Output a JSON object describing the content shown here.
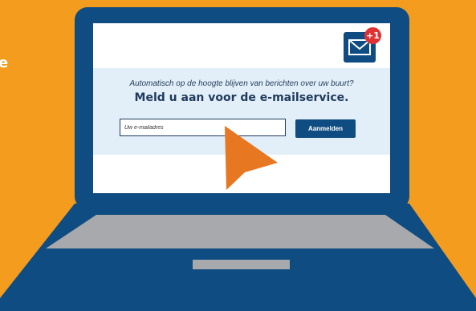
{
  "edge_text": "e",
  "mail_icon": {
    "icon": "envelope-icon",
    "badge": "+1"
  },
  "signup": {
    "prompt": "Automatisch op de hoogte blijven van berichten over uw buurt?",
    "title": "Meld u aan voor de e-mailservice.",
    "email_placeholder": "Uw e-mailadres",
    "submit_label": "Aanmelden"
  },
  "colors": {
    "background": "#F39C1E",
    "laptop": "#0F4C81",
    "keyboard": "#A7A9AC",
    "badge": "#E03234",
    "band": "#E3EFF8",
    "cursor": "#E87722"
  }
}
